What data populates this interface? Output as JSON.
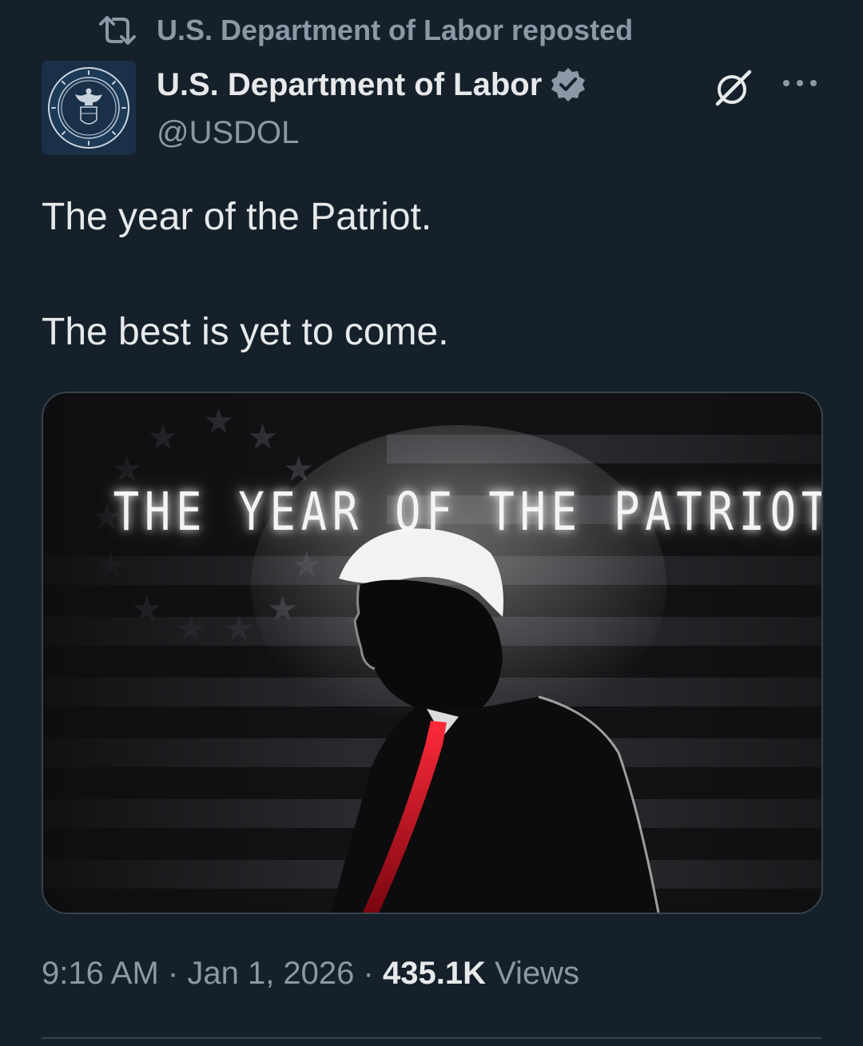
{
  "repost": {
    "label": "U.S. Department of Labor reposted"
  },
  "author": {
    "name": "U.S. Department of Labor",
    "handle": "@USDOL",
    "verified_color": "#8b98a5"
  },
  "post": {
    "lines": [
      "The year of the Patriot.",
      "The best is yet to come."
    ],
    "media_title": "THE YEAR OF THE PATRIOT"
  },
  "meta": {
    "time": "9:16 AM",
    "separator": "·",
    "date": "Jan 1, 2026",
    "views_count": "435.1K",
    "views_label": "Views"
  },
  "icons": {
    "repost": "repost-icon",
    "verified": "verified-badge-icon",
    "grok": "grok-icon",
    "more": "more-options-icon"
  },
  "colors": {
    "background": "#15202b",
    "primary_text": "#e7e9ea",
    "secondary_text": "#8b98a5",
    "border": "#38444d",
    "tie_red": "#c8102e"
  }
}
